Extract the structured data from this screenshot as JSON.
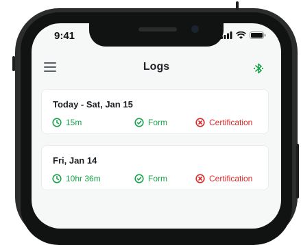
{
  "status_bar": {
    "time": "9:41"
  },
  "app_bar": {
    "title": "Logs"
  },
  "logs": [
    {
      "date": "Today - Sat, Jan 15",
      "duration": "15m",
      "form": "Form",
      "certification": "Certification"
    },
    {
      "date": "Fri, Jan 14",
      "duration": "10hr 36m",
      "form": "Form",
      "certification": "Certification"
    }
  ],
  "colors": {
    "accent_green": "#16a34a",
    "error_red": "#dc2626"
  },
  "icons": {
    "menu": "hamburger-menu-icon",
    "bluetooth": "bluetooth-icon",
    "duration": "clock-icon",
    "form": "check-circle-icon",
    "certification": "x-circle-icon"
  }
}
